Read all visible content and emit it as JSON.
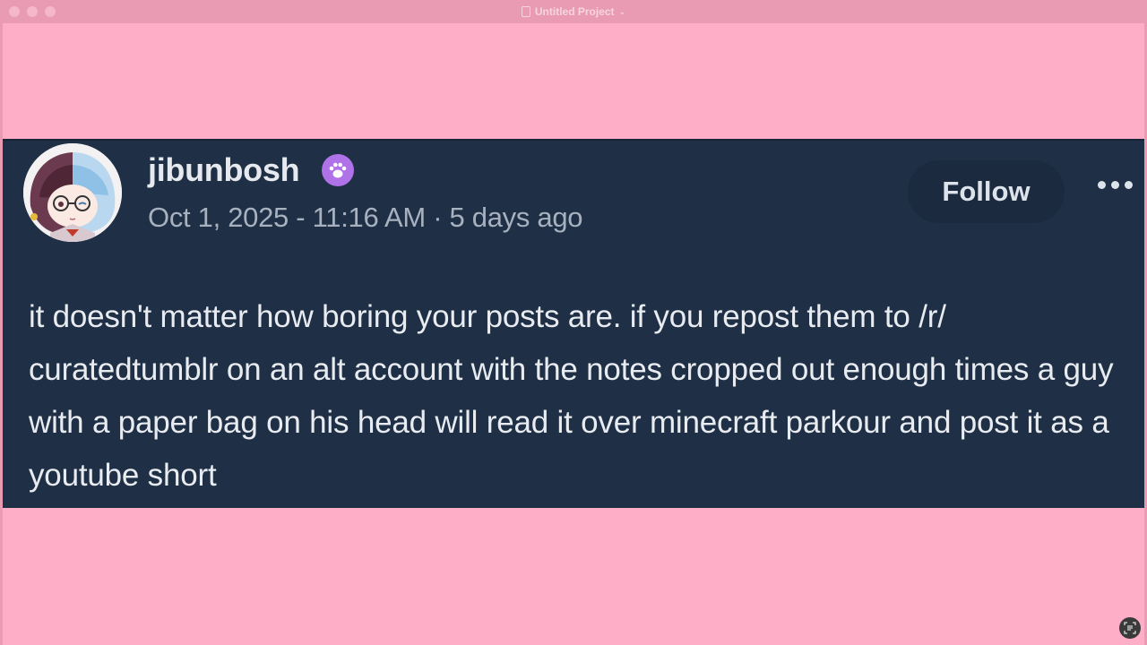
{
  "window": {
    "title": "Untitled Project",
    "title_chevron": "⌄"
  },
  "post": {
    "username": "jibunbosh",
    "badge_icon": "paw-icon",
    "timestamp": "Oct 1, 2025 - 11:16 AM · 5 days ago",
    "follow_label": "Follow",
    "more_icon": "ellipsis-icon",
    "body": "it doesn't matter how boring your posts are. if you repost them to /r/ curatedtumblr on an alt account with the notes cropped out enough times a guy with a paper bag on his head will read it over minecraft parkour and post it as a youtube short"
  },
  "colors": {
    "background": "#ffaec8",
    "post_background": "#1f2f45",
    "badge": "#b072e8"
  }
}
